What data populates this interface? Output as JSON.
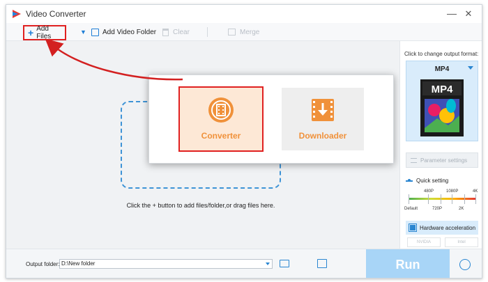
{
  "window": {
    "title": "Video Converter",
    "minimize_glyph": "—",
    "close_glyph": "✕"
  },
  "toolbar": {
    "add_files": "Add Files",
    "add_video_folder": "Add Video Folder",
    "clear": "Clear",
    "merge": "Merge"
  },
  "popup": {
    "converter_label": "Converter",
    "downloader_label": "Downloader"
  },
  "main": {
    "drop_hint": "Click the + button to add files/folder,or drag files here."
  },
  "side": {
    "format_hint": "Click to change output format:",
    "format_name": "MP4",
    "format_art_text": "MP4",
    "parameter_settings": "Parameter settings",
    "quick_setting": "Quick setting",
    "quality_top": [
      "480P",
      "1080P",
      "4K"
    ],
    "quality_bottom": [
      "Default",
      "720P",
      "2K"
    ],
    "hardware_acceleration": "Hardware acceleration",
    "vendors": [
      "NVIDIA",
      "Intel"
    ]
  },
  "bottom": {
    "output_folder_label": "Output folder:",
    "output_folder_value": "D:\\New folder",
    "run_label": "Run"
  },
  "colors": {
    "accent_blue": "#2a86d1",
    "highlight_red": "#e02020",
    "converter_orange": "#f0913a"
  },
  "icons": [
    "app-logo-icon",
    "plus-icon",
    "folder-icon",
    "trash-icon",
    "merge-icon",
    "film-reel-icon",
    "download-icon",
    "sliders-icon",
    "chip-icon",
    "open-folder-icon",
    "alarm-clock-icon"
  ]
}
